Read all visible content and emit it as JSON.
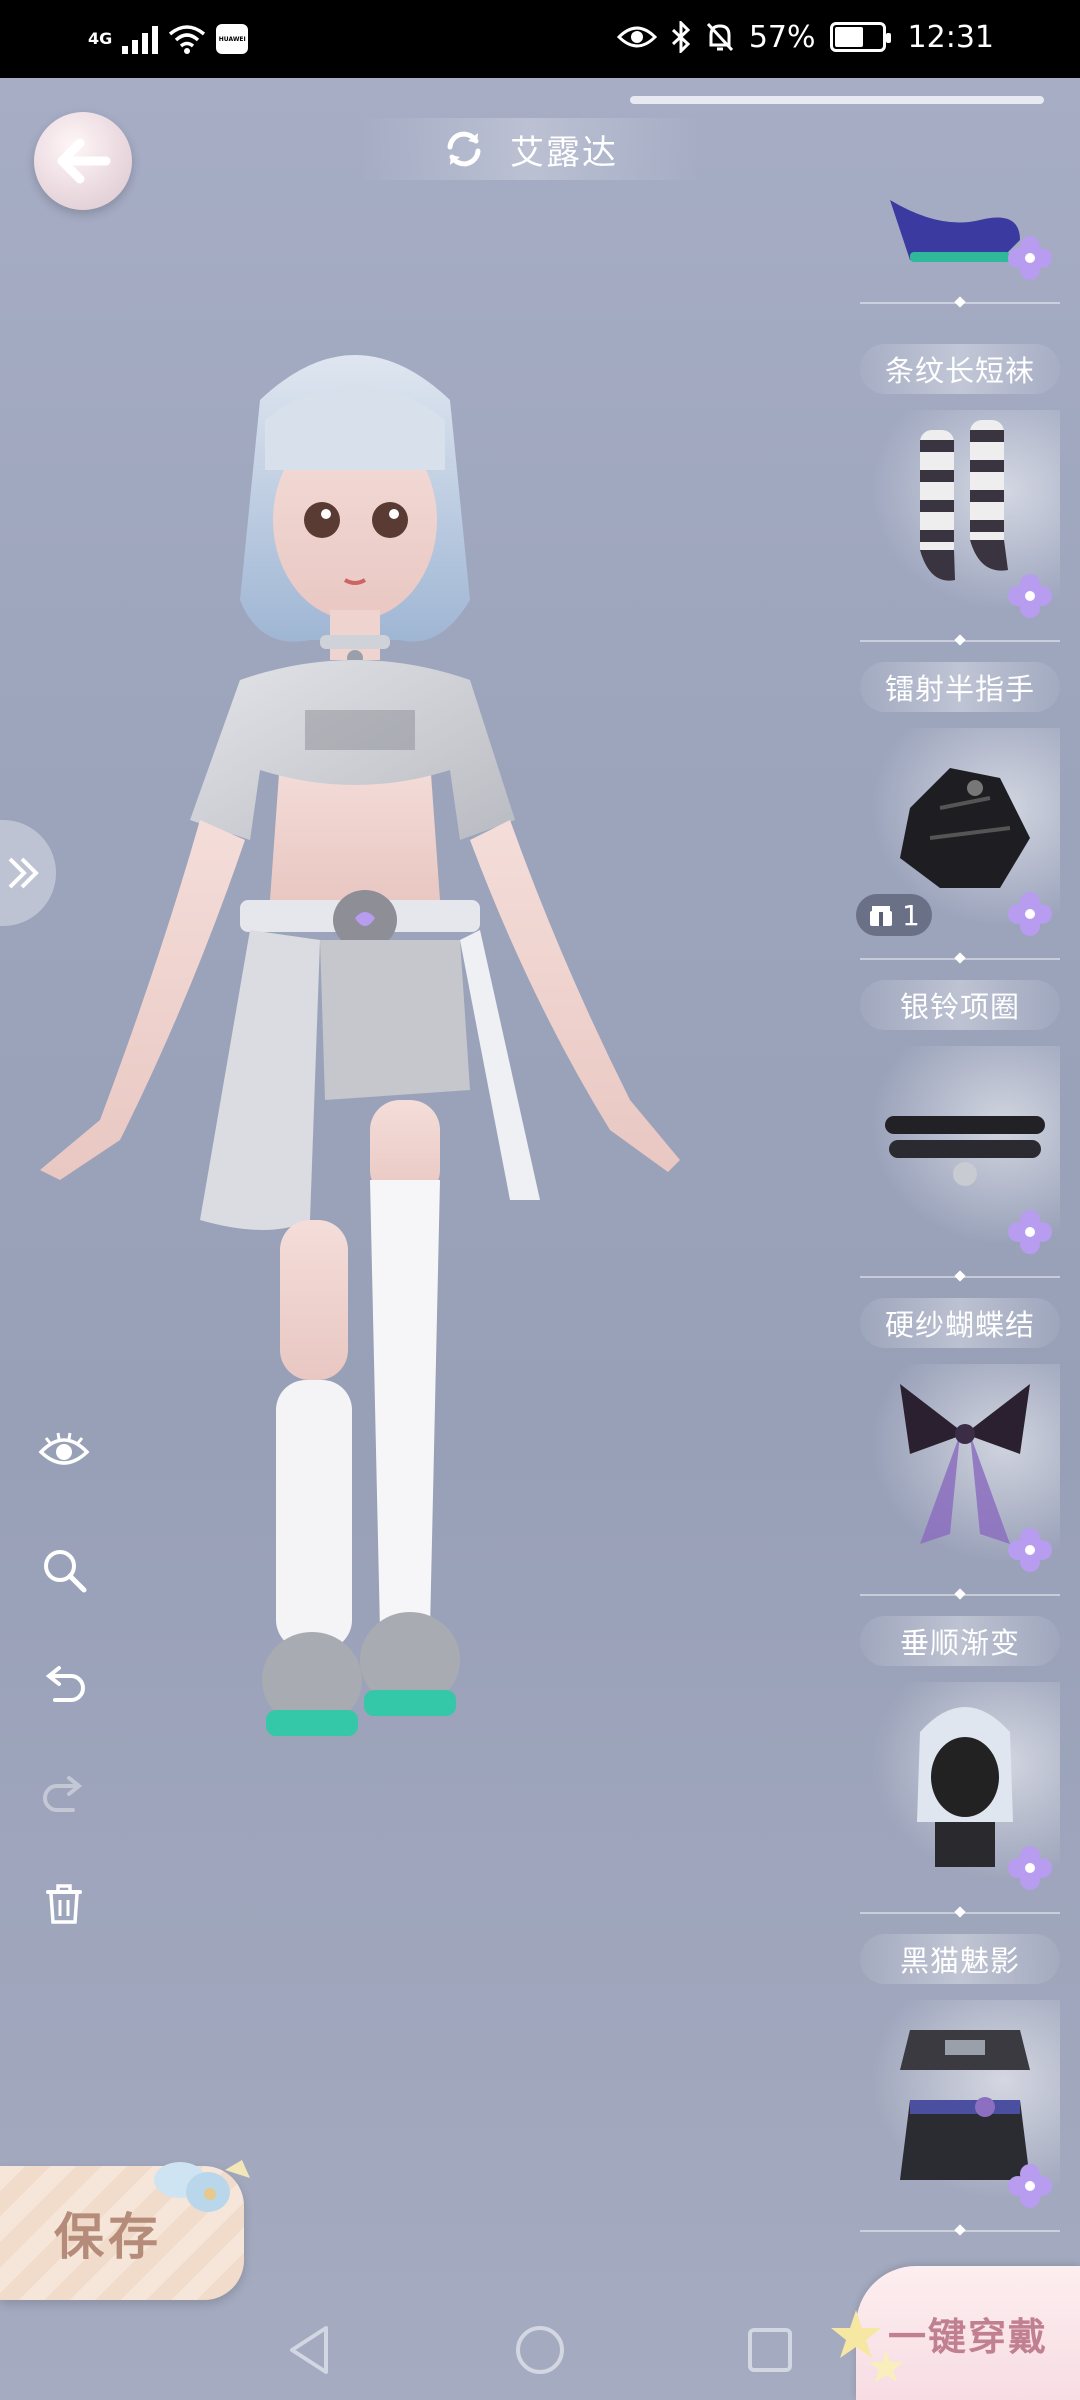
{
  "status_bar": {
    "network_label": "4G",
    "brand_badge": "HUAWEI",
    "battery_percent": "57%",
    "battery_level": 0.57,
    "time": "12:31"
  },
  "header": {
    "character_name": "艾露达"
  },
  "items": [
    {
      "label": "条纹长短袜",
      "thumb_icon": "striped-socks-icon"
    },
    {
      "label": "镭射半指手",
      "thumb_icon": "fingerless-gloves-icon",
      "stock_count": "1"
    },
    {
      "label": "银铃项圈",
      "thumb_icon": "bell-choker-icon"
    },
    {
      "label": "硬纱蝴蝶结",
      "thumb_icon": "gauze-bow-icon"
    },
    {
      "label": "垂顺渐变",
      "thumb_icon": "gradient-hair-icon"
    },
    {
      "label": "黑猫魅影",
      "thumb_icon": "black-cat-outfit-icon"
    }
  ],
  "tools": [
    "eye-icon",
    "zoom-icon",
    "undo-icon",
    "redo-icon",
    "trash-icon"
  ],
  "buttons": {
    "save_label": "保存",
    "one_click_wear_label": "一键穿戴"
  },
  "colors": {
    "background": "#9da5bd",
    "clover": "#b79cf0",
    "save_text": "#b58b7a",
    "wear_text": "#c08090"
  }
}
